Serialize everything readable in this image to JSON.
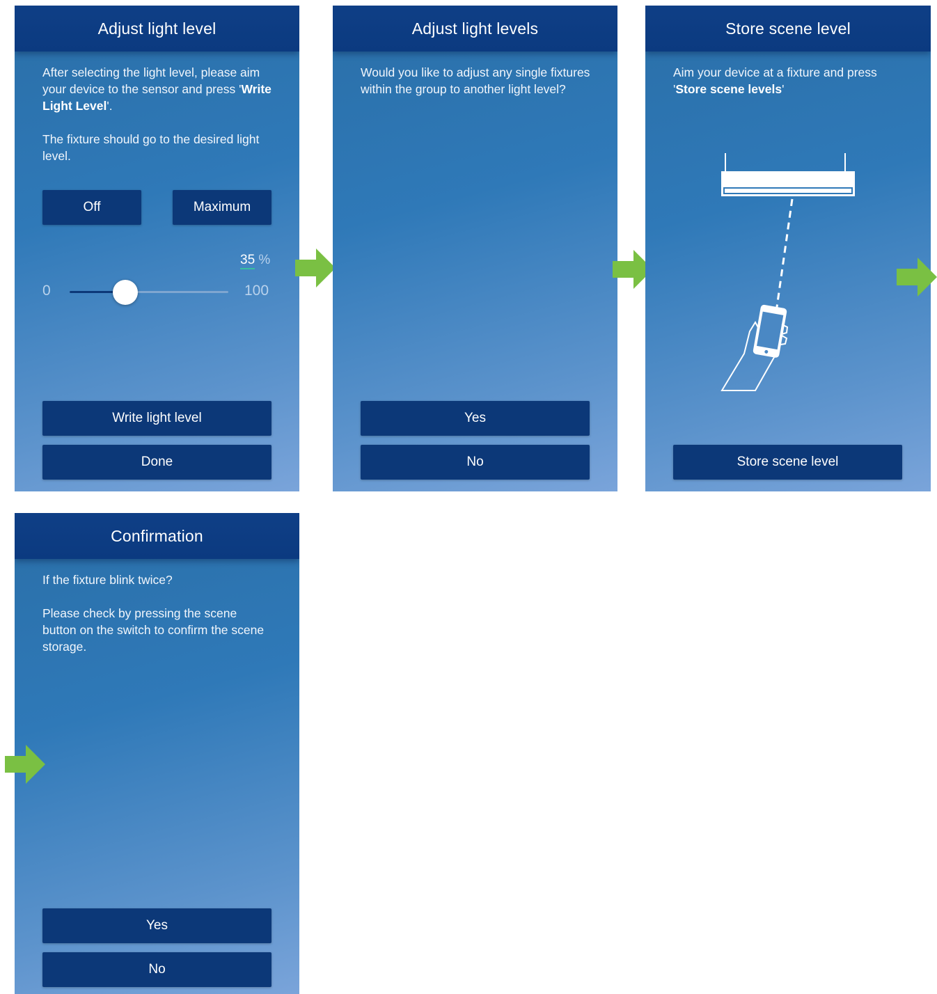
{
  "screens": {
    "adjust": {
      "title": "Adjust light level",
      "para1_a": "After selecting the light level, please aim your device to the sensor and press '",
      "para1_bold": "Write Light Level",
      "para1_b": "'.",
      "para2": "The fixture should go to the desired light level.",
      "off_label": "Off",
      "max_label": "Maximum",
      "slider": {
        "value": 35,
        "unit": "%",
        "min_label": "0",
        "max_label": "100"
      },
      "write_label": "Write light level",
      "done_label": "Done"
    },
    "levels": {
      "title": "Adjust light levels",
      "question": "Would you like to adjust any single fixtures within the group to another light level?",
      "yes_label": "Yes",
      "no_label": "No"
    },
    "store": {
      "title": "Store scene level",
      "instr_a": "Aim your device at a fixture and press '",
      "instr_bold": "Store scene levels",
      "instr_b": "'",
      "store_label": "Store scene level"
    },
    "confirm": {
      "title": "Confirmation",
      "para1": "If the fixture blink twice?",
      "para2": "Please check by pressing the scene button on the switch to confirm the scene storage.",
      "yes_label": "Yes",
      "no_label": "No"
    }
  },
  "colors": {
    "arrow": "#7ac043",
    "header": "#0b3a80",
    "button": "#0c3878",
    "slider_active": "#0c3878",
    "percent_underline": "#37c0a0"
  }
}
